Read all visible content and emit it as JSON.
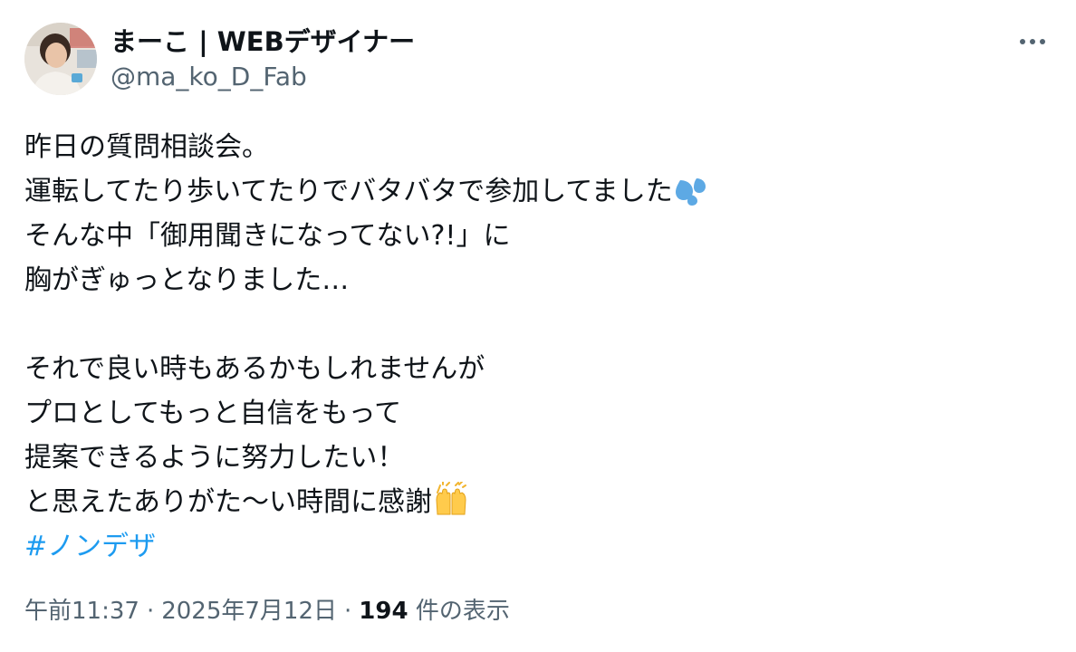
{
  "author": {
    "display_name": "まーこ | WEBデザイナー",
    "handle": "@ma_ko_D_Fab"
  },
  "body": {
    "lines": [
      "昨日の質問相談会。",
      "運転してたり歩いてたりでバタバタで参加してました",
      "そんな中「御用聞きになってない?!」に",
      "胸がぎゅっとなりました…",
      "",
      "それで良い時もあるかもしれませんが",
      "プロとしてもっと自信をもって",
      "提案できるように努力したい！",
      "と思えたありがた〜い時間に感謝"
    ],
    "hashtag": "#ノンデザ"
  },
  "emojis": {
    "line2": "sweat-droplets-icon",
    "line9": "raising-hands-icon"
  },
  "meta": {
    "time": "午前11:37",
    "separator": "·",
    "date": "2025年7月12日",
    "views_count": "194",
    "views_label": "件の表示"
  },
  "colors": {
    "link": "#1d9bf0",
    "secondary_text": "#536471",
    "primary_text": "#0f1419"
  }
}
